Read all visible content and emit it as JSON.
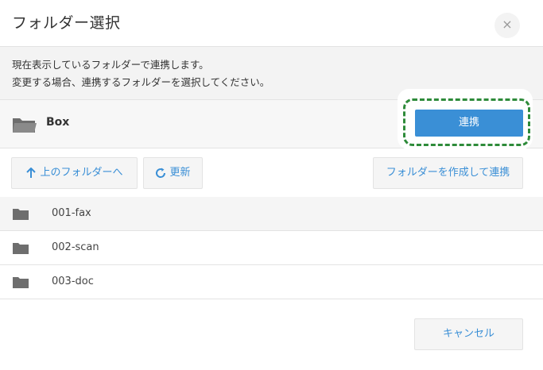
{
  "dialog": {
    "title": "フォルダー選択",
    "close_label": "×"
  },
  "description": {
    "line1": "現在表示しているフォルダーで連携します。",
    "line2": "変更する場合、連携するフォルダーを選択してください。"
  },
  "current_folder": {
    "name": "Box",
    "icon": "folder-open-icon",
    "link_button_label": "連携"
  },
  "toolbar": {
    "up_label": "上のフォルダーへ",
    "up_icon": "arrow-up-icon",
    "refresh_label": "更新",
    "refresh_icon": "refresh-icon",
    "create_label": "フォルダーを作成して連携"
  },
  "folders": [
    {
      "name": "001-fax",
      "icon": "folder-icon"
    },
    {
      "name": "002-scan",
      "icon": "folder-icon"
    },
    {
      "name": "003-doc",
      "icon": "folder-icon"
    }
  ],
  "footer": {
    "cancel_label": "キャンセル"
  },
  "colors": {
    "accent": "#3a8fd6",
    "highlight_dash": "#2e8b3a",
    "panel_bg": "#f3f3f3",
    "folder_icon": "#6e6e6e"
  }
}
